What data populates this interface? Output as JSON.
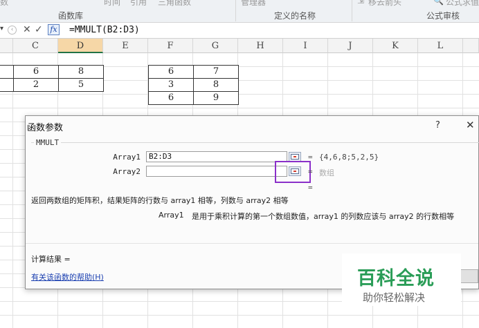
{
  "ribbon": {
    "top_items": [
      "数",
      "时间",
      "引用",
      "三角函数",
      "管理器",
      "移去箭头",
      "公式求值"
    ],
    "group_labels": [
      "函数库",
      "定义的名称",
      "公式审核"
    ]
  },
  "formula_bar": {
    "formula": "=MMULT(B2:D3)"
  },
  "columns": [
    "C",
    "D",
    "E",
    "F",
    "G",
    "H",
    "I",
    "J",
    "K",
    "L"
  ],
  "selected_column": "D",
  "sheet": {
    "matrix1": [
      [
        "6",
        "8"
      ],
      [
        "2",
        "5"
      ]
    ],
    "matrix2": [
      [
        "6",
        "7"
      ],
      [
        "3",
        "8"
      ],
      [
        "6",
        "9"
      ]
    ]
  },
  "dialog": {
    "title": "函数参数",
    "help_icon": "?",
    "close_icon": "✕",
    "function_name": "MMULT",
    "arg1_label": "Array1",
    "arg1_value": "B2:D3",
    "arg1_result": "{4,6,8;5,2,5}",
    "arg2_label": "Array2",
    "arg2_value": "",
    "arg2_result": "数组",
    "equals": "=",
    "description": "返回两数组的矩阵积，结果矩阵的行数与 array1 相等，列数与 array2 相等",
    "arg_description_label": "Array1",
    "arg_description": "是用于乘积计算的第一个数组数值，array1 的列数应该与 array2 的行数相等",
    "result_label": "计算结果 =",
    "help_link": "有关该函数的帮助(H)"
  },
  "watermark": {
    "title": "百科全说",
    "subtitle": "助你轻松解决"
  }
}
